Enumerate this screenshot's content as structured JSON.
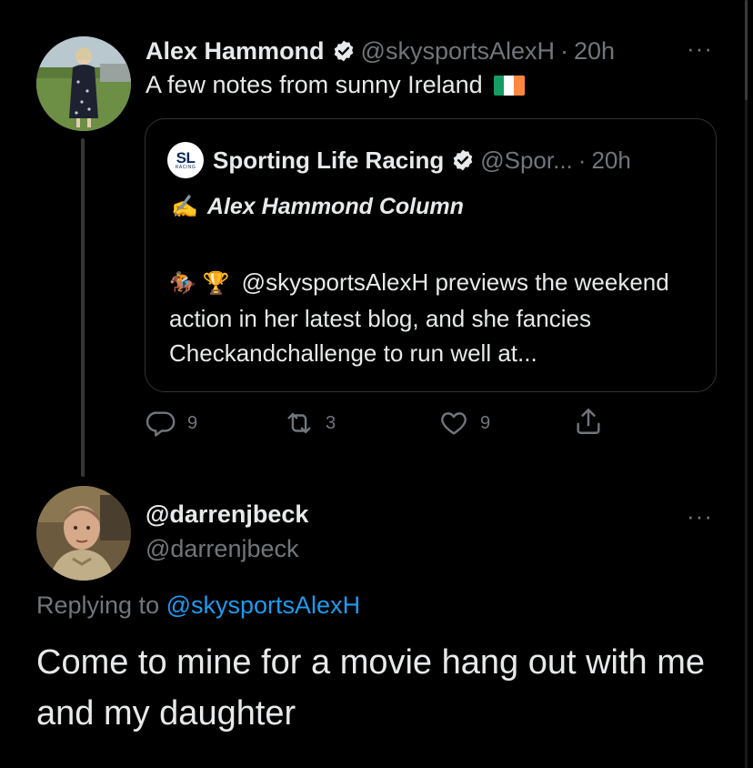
{
  "tweet": {
    "author_name": "Alex Hammond",
    "author_handle": "@skysportsAlexH",
    "separator": "·",
    "time": "20h",
    "text": "A few notes from sunny Ireland",
    "flag_colors": [
      "#169b62",
      "#ffffff",
      "#ff883e"
    ],
    "more_label": "···",
    "quote": {
      "logo_text": "SL",
      "logo_subtext": "RACING",
      "author_name": "Sporting Life Racing",
      "author_handle": "@Spor...",
      "time": "20h",
      "title_icon": "✍️",
      "title": "Alex Hammond Column",
      "body_emojis": "🏇 🏆",
      "body": "@skysportsAlexH previews the weekend action in her latest blog, and she fancies Checkandchallenge to run well at..."
    },
    "actions": {
      "replies": "9",
      "retweets": "3",
      "likes": "9"
    }
  },
  "reply": {
    "author_name": "@darrenjbeck",
    "author_handle": "@darrenjbeck",
    "more_label": "···",
    "replying_prefix": "Replying to",
    "replying_to": "@skysportsAlexH",
    "text": "Come to mine for a movie hang out with me and my daughter"
  },
  "colors": {
    "background": "#000000",
    "text_primary": "#e7e9ea",
    "text_muted": "#71767b",
    "link": "#1d9bf0",
    "border": "#2f3336"
  }
}
